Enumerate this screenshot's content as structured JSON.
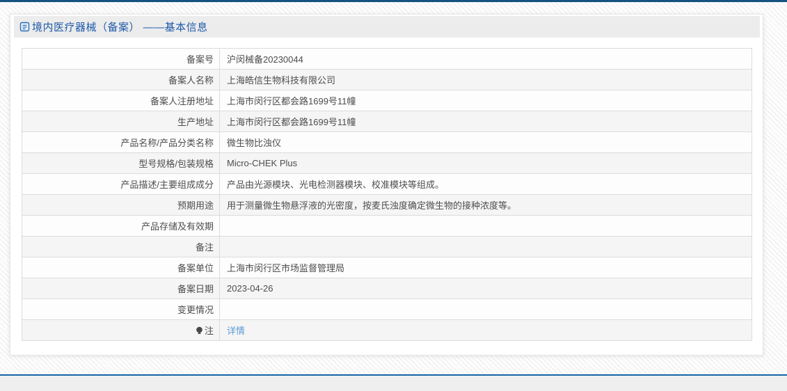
{
  "page": {
    "title": "境内医疗器械（备案） ——基本信息",
    "colors": {
      "top_bar": "#15537f",
      "title_text": "#1e5aa9",
      "header_background": "#ececec",
      "row_alt_background": "#f5f5f5",
      "link": "#5b9bd5",
      "footer_line": "#1565a5",
      "footer_background": "#efefef",
      "table_border": "#dcdcdc",
      "body_text": "#4d4d4d"
    },
    "icons": {
      "title_icon": "document-icon",
      "note_icon": "bulb-icon"
    }
  },
  "table": {
    "rows": [
      {
        "label": "备案号",
        "value": "沪闵械备20230044",
        "link": false,
        "icon": ""
      },
      {
        "label": "备案人名称",
        "value": "上海皓信生物科技有限公司",
        "link": false,
        "icon": ""
      },
      {
        "label": "备案人注册地址",
        "value": "上海市闵行区都会路1699号11幢",
        "link": false,
        "icon": ""
      },
      {
        "label": "生产地址",
        "value": "上海市闵行区都会路1699号11幢",
        "link": false,
        "icon": ""
      },
      {
        "label": "产品名称/产品分类名称",
        "value": "微生物比浊仪",
        "link": false,
        "icon": ""
      },
      {
        "label": "型号规格/包装规格",
        "value": "Micro-CHEK Plus",
        "link": false,
        "icon": ""
      },
      {
        "label": "产品描述/主要组成成分",
        "value": "产品由光源模块、光电检测器模块、校准模块等组成。",
        "link": false,
        "icon": ""
      },
      {
        "label": "预期用途",
        "value": "用于测量微生物悬浮液的光密度，按麦氏浊度确定微生物的接种浓度等。",
        "link": false,
        "icon": ""
      },
      {
        "label": "产品存储及有效期",
        "value": "",
        "link": false,
        "icon": ""
      },
      {
        "label": "备注",
        "value": "",
        "link": false,
        "icon": ""
      },
      {
        "label": "备案单位",
        "value": "上海市闵行区市场监督管理局",
        "link": false,
        "icon": ""
      },
      {
        "label": "备案日期",
        "value": "2023-04-26",
        "link": false,
        "icon": ""
      },
      {
        "label": "变更情况",
        "value": "",
        "link": false,
        "icon": ""
      },
      {
        "label": "注",
        "value": "详情",
        "link": true,
        "icon": "bulb-icon"
      }
    ]
  }
}
